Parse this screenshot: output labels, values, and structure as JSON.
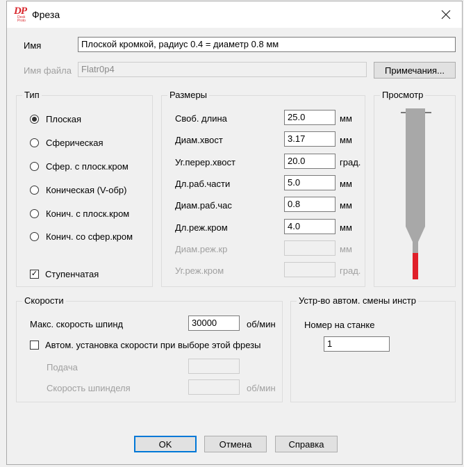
{
  "window": {
    "title": "Фреза",
    "logo_text": "DP",
    "logo_subtext": "Desk Proto"
  },
  "name": {
    "label": "Имя",
    "value": "Плоской кромкой, радиус 0.4 = диаметр 0.8 мм"
  },
  "filename": {
    "label": "Имя файла",
    "value": "Flatr0p4",
    "notes_button": "Примечания..."
  },
  "type_group": {
    "title": "Тип",
    "options": [
      {
        "label": "Плоская",
        "selected": true
      },
      {
        "label": "Сферическая",
        "selected": false
      },
      {
        "label": "Сфер. с плоск.кром",
        "selected": false
      },
      {
        "label": "Коническая (V-обр)",
        "selected": false
      },
      {
        "label": "Конич. с плоск.кром",
        "selected": false
      },
      {
        "label": "Конич. со сфер.кром",
        "selected": false
      }
    ],
    "stepped": {
      "label": "Ступенчатая",
      "checked": true
    }
  },
  "dimensions": {
    "title": "Размеры",
    "rows": [
      {
        "label": "Своб. длина",
        "value": "25.0",
        "unit": "мм",
        "enabled": true
      },
      {
        "label": "Диам.хвост",
        "value": "3.17",
        "unit": "мм",
        "enabled": true
      },
      {
        "label": "Уг.перер.хвост",
        "value": "20.0",
        "unit": "град.",
        "enabled": true
      },
      {
        "label": "Дл.раб.части",
        "value": "5.0",
        "unit": "мм",
        "enabled": true
      },
      {
        "label": "Диам.раб.час",
        "value": "0.8",
        "unit": "мм",
        "enabled": true
      },
      {
        "label": "Дл.реж.кром",
        "value": "4.0",
        "unit": "мм",
        "enabled": true
      },
      {
        "label": "Диам.реж.кр",
        "value": "",
        "unit": "мм",
        "enabled": false
      },
      {
        "label": "Уг.реж.кром",
        "value": "",
        "unit": "град.",
        "enabled": false
      }
    ]
  },
  "preview": {
    "title": "Просмотр",
    "shank_color": "#a8a8a8",
    "tip_color": "#e0202a"
  },
  "speeds": {
    "title": "Скорости",
    "max_spindle_label": "Макс. скорость шпинд",
    "max_spindle_value": "30000",
    "max_spindle_unit": "об/мин",
    "auto_label": "Автом. установка скорости при выборе этой фрезы",
    "auto_checked": false,
    "feed_label": "Подача",
    "spindle_label": "Скорость шпинделя",
    "spindle_unit": "об/мин"
  },
  "atc": {
    "title": "Устр-во автом. смены инстр",
    "machine_number_label": "Номер на станке",
    "machine_number_value": "1"
  },
  "buttons": {
    "ok": "OK",
    "cancel": "Отмена",
    "help": "Справка"
  }
}
